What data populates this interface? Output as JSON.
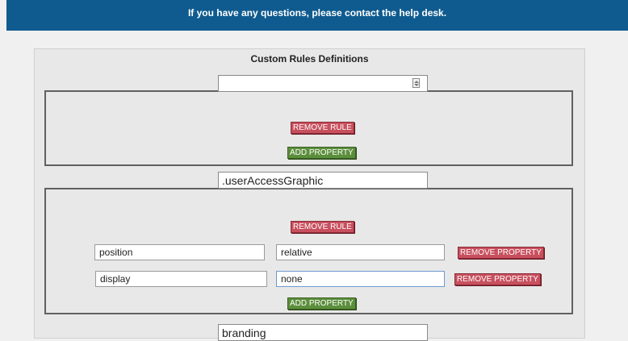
{
  "header": {
    "message": "If you have any questions, please contact the help desk."
  },
  "panel": {
    "title": "Custom Rules Definitions"
  },
  "rules": [
    {
      "selector": "",
      "remove_label": "REMOVE RULE",
      "add_label": "ADD PROPERTY",
      "properties": []
    },
    {
      "selector": ".userAccessGraphic",
      "remove_label": "REMOVE RULE",
      "add_label": "ADD PROPERTY",
      "properties": [
        {
          "name": "position",
          "value": "relative",
          "remove_label": "REMOVE PROPERTY"
        },
        {
          "name": "display",
          "value": "none",
          "remove_label": "REMOVE PROPERTY"
        }
      ]
    },
    {
      "selector": "branding"
    }
  ],
  "colors": {
    "header_bg": "#0f5b8f",
    "remove_btn": "#c8505e",
    "add_btn": "#5c8f3c"
  }
}
